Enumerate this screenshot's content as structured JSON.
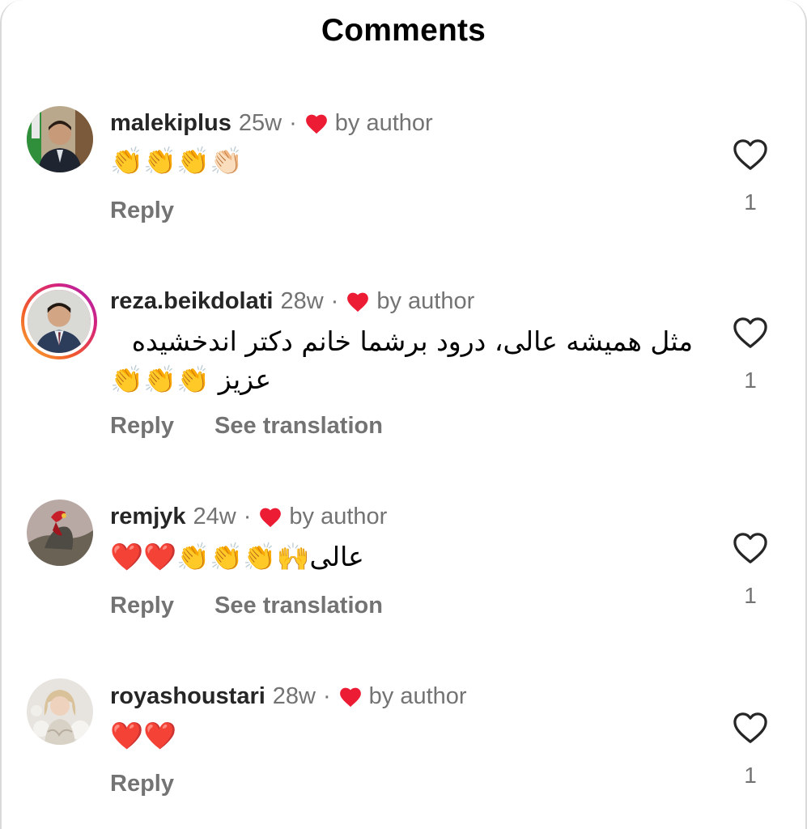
{
  "header": {
    "title": "Comments"
  },
  "comments": [
    {
      "username": "malekiplus",
      "time": "25w",
      "separator": "·",
      "author_liked": "by author",
      "text": "👏👏👏👏🏻",
      "reply_label": "Reply",
      "translate_label": "",
      "like_count": "1"
    },
    {
      "username": "reza.beikdolati",
      "time": "28w",
      "separator": "·",
      "author_liked": "by author",
      "text_line1": "مثل همیشه عالی، درود برشما خانم دکتر اندخشیده",
      "text_line2": "عزیز 👏👏👏",
      "reply_label": "Reply",
      "translate_label": "See translation",
      "like_count": "1"
    },
    {
      "username": "remjyk",
      "time": "24w",
      "separator": "·",
      "author_liked": "by author",
      "text": "عالی🙌👏👏👏❤️❤️",
      "reply_label": "Reply",
      "translate_label": "See translation",
      "like_count": "1"
    },
    {
      "username": "royashoustari",
      "time": "28w",
      "separator": "·",
      "author_liked": "by author",
      "text": "❤️❤️",
      "reply_label": "Reply",
      "translate_label": "",
      "like_count": "1"
    }
  ],
  "colors": {
    "text_primary": "#262626",
    "text_secondary": "#737373",
    "author_heart": "#ed1c35",
    "story_ring": [
      "#f9b233",
      "#f15b2a",
      "#d6247a",
      "#a724b8"
    ]
  },
  "icons": {
    "author_like": "red-heart-icon",
    "like": "heart-outline-icon"
  }
}
